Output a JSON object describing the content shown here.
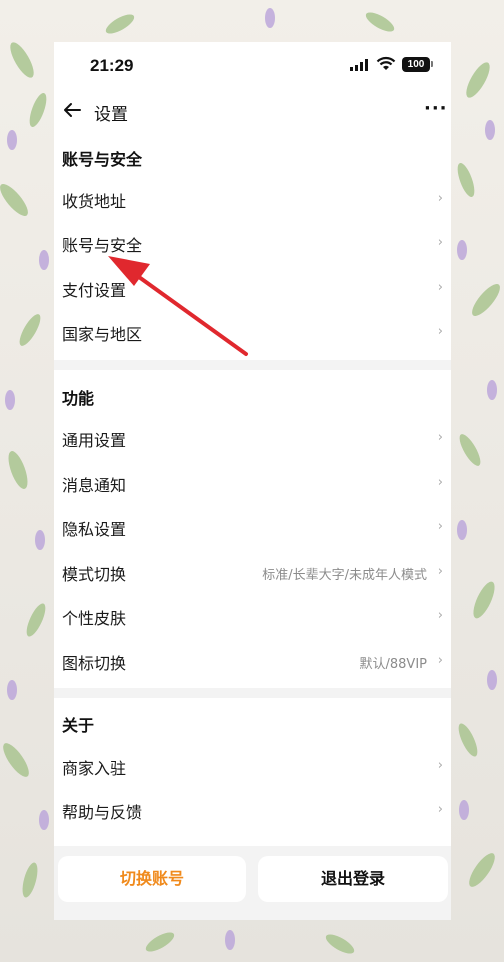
{
  "status_bar": {
    "time": "21:29",
    "battery": "100"
  },
  "nav": {
    "title": "设置"
  },
  "sections": [
    {
      "title": "账号与安全",
      "items": [
        {
          "label": "收货地址",
          "value": ""
        },
        {
          "label": "账号与安全",
          "value": ""
        },
        {
          "label": "支付设置",
          "value": ""
        },
        {
          "label": "国家与地区",
          "value": ""
        }
      ]
    },
    {
      "title": "功能",
      "items": [
        {
          "label": "通用设置",
          "value": ""
        },
        {
          "label": "消息通知",
          "value": ""
        },
        {
          "label": "隐私设置",
          "value": ""
        },
        {
          "label": "模式切换",
          "value": "标准/长辈大字/未成年人模式"
        },
        {
          "label": "个性皮肤",
          "value": ""
        },
        {
          "label": "图标切换",
          "value": "默认/88VIP"
        }
      ]
    },
    {
      "title": "关于",
      "items": [
        {
          "label": "商家入驻",
          "value": ""
        },
        {
          "label": "帮助与反馈",
          "value": ""
        }
      ]
    }
  ],
  "buttons": {
    "switch_account": "切换账号",
    "logout": "退出登录"
  },
  "colors": {
    "accent": "#f08a1c",
    "annotation_arrow": "#e0282e"
  }
}
